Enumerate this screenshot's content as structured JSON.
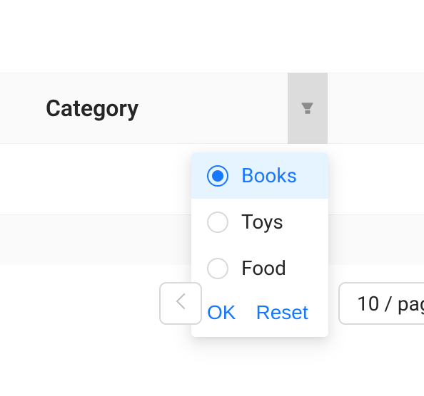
{
  "header": {
    "column_title": "Category"
  },
  "filter": {
    "options": [
      {
        "label": "Books",
        "selected": true
      },
      {
        "label": "Toys",
        "selected": false
      },
      {
        "label": "Food",
        "selected": false
      }
    ],
    "ok_label": "OK",
    "reset_label": "Reset"
  },
  "pagination": {
    "page_size_label": "10 / pag"
  }
}
